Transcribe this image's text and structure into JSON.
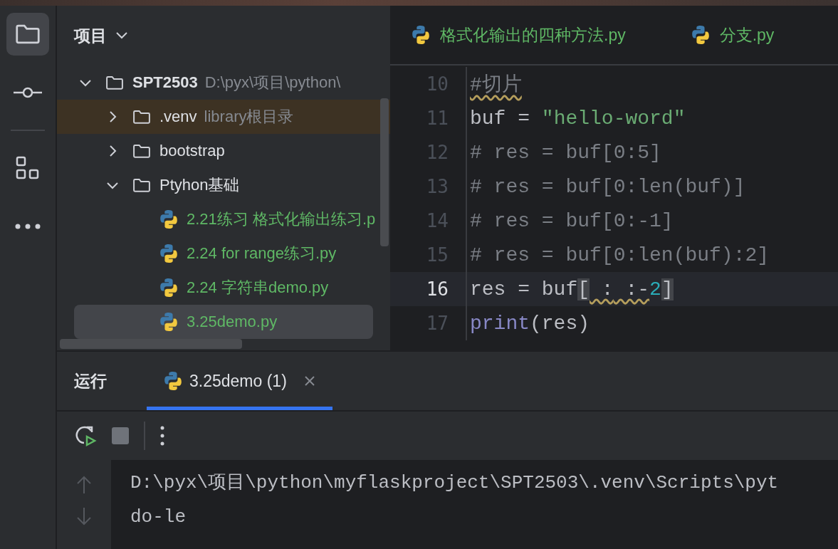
{
  "activity_bar": {
    "items": [
      {
        "kind": "folder",
        "selected": true
      },
      {
        "kind": "commit",
        "selected": false
      },
      {
        "kind": "plugins",
        "selected": false
      },
      {
        "kind": "more",
        "selected": false
      }
    ]
  },
  "project": {
    "title": "项目",
    "tree": [
      {
        "label": "SPT2503",
        "hint": "D:\\pyx\\项目\\python\\",
        "kind": "folder",
        "expanded": true,
        "excluded": false,
        "added": false,
        "selected": false,
        "children": [
          {
            "label": ".venv",
            "hint": "library根目录",
            "kind": "folder",
            "expanded": false,
            "excluded": true,
            "added": false,
            "selected": false
          },
          {
            "label": "bootstrap",
            "kind": "folder",
            "expanded": false,
            "excluded": false,
            "added": false,
            "selected": false
          },
          {
            "label": "Ptyhon基础",
            "kind": "folder",
            "expanded": true,
            "excluded": false,
            "added": false,
            "selected": false,
            "children": [
              {
                "label": "2.21练习 格式化输出练习.p",
                "kind": "python",
                "excluded": false,
                "added": true,
                "selected": false
              },
              {
                "label": "2.24 for range练习.py",
                "kind": "python",
                "excluded": false,
                "added": true,
                "selected": false
              },
              {
                "label": "2.24 字符串demo.py",
                "kind": "python",
                "excluded": false,
                "added": true,
                "selected": false
              },
              {
                "label": "3.25demo.py",
                "kind": "python",
                "excluded": false,
                "added": true,
                "selected": true
              }
            ]
          }
        ]
      }
    ]
  },
  "editor": {
    "tabs": [
      {
        "label": "格式化输出的四种方法.py",
        "added": true,
        "selected": false
      },
      {
        "label": "分支.py",
        "added": true,
        "selected": false
      }
    ],
    "lines": [
      {
        "number": "10",
        "current": false,
        "tokens": [
          {
            "text": "#切片",
            "kind": "comment",
            "warning": true
          }
        ]
      },
      {
        "number": "11",
        "current": false,
        "tokens": [
          {
            "text": "buf = ",
            "kind": "plain"
          },
          {
            "text": "\"hello-word\"",
            "kind": "string"
          }
        ]
      },
      {
        "number": "12",
        "current": false,
        "tokens": [
          {
            "text": "# res = buf[0:5]",
            "kind": "comment"
          }
        ]
      },
      {
        "number": "13",
        "current": false,
        "tokens": [
          {
            "text": "# res = buf[0:len(buf)]",
            "kind": "comment"
          }
        ]
      },
      {
        "number": "14",
        "current": false,
        "tokens": [
          {
            "text": "# res = buf[0:-1]",
            "kind": "comment"
          }
        ]
      },
      {
        "number": "15",
        "current": false,
        "tokens": [
          {
            "text": "# res = buf[0:len(buf):2]",
            "kind": "comment"
          }
        ]
      },
      {
        "number": "16",
        "current": true,
        "tokens": [
          {
            "text": "res = buf",
            "kind": "plain"
          },
          {
            "text": "[",
            "kind": "plain",
            "matched": true
          },
          {
            "text": " :",
            "kind": "plain",
            "warning": true
          },
          {
            "text": " :-",
            "kind": "plain",
            "warning": true
          },
          {
            "text": "2",
            "kind": "number"
          },
          {
            "text": "]",
            "kind": "plain",
            "matched": true
          }
        ]
      },
      {
        "number": "17",
        "current": false,
        "tokens": [
          {
            "text": "print",
            "kind": "builtin"
          },
          {
            "text": "(res)",
            "kind": "plain"
          }
        ]
      }
    ]
  },
  "run_panel": {
    "title": "运行",
    "tabs": [
      {
        "label": "3.25demo (1)",
        "selected": true
      }
    ],
    "output": [
      "D:\\pyx\\项目\\python\\myflaskproject\\SPT2503\\.venv\\Scripts\\pyt",
      "do-le"
    ]
  }
}
